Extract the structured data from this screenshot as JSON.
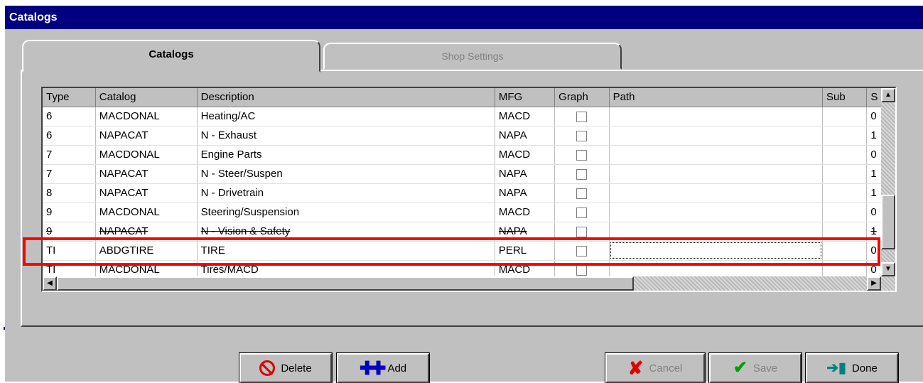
{
  "window": {
    "title": "Catalogs"
  },
  "tabs": [
    {
      "label": "Catalogs",
      "active": true
    },
    {
      "label": "Shop Settings",
      "active": false
    }
  ],
  "grid": {
    "columns": [
      "Type",
      "Catalog",
      "Description",
      "MFG",
      "Graph",
      "Path",
      "Sub",
      "S"
    ],
    "rows": [
      {
        "type": "6",
        "catalog": "MACDONAL",
        "description": "Heating/AC",
        "mfg": "MACD",
        "graph": false,
        "path": "",
        "sub": "",
        "s": "0"
      },
      {
        "type": "6",
        "catalog": "NAPACAT",
        "description": "N - Exhaust",
        "mfg": "NAPA",
        "graph": false,
        "path": "",
        "sub": "",
        "s": "1"
      },
      {
        "type": "7",
        "catalog": "MACDONAL",
        "description": "Engine Parts",
        "mfg": "MACD",
        "graph": false,
        "path": "",
        "sub": "",
        "s": "0"
      },
      {
        "type": "7",
        "catalog": "NAPACAT",
        "description": "N - Steer/Suspen",
        "mfg": "NAPA",
        "graph": false,
        "path": "",
        "sub": "",
        "s": "1"
      },
      {
        "type": "8",
        "catalog": "NAPACAT",
        "description": "N - Drivetrain",
        "mfg": "NAPA",
        "graph": false,
        "path": "",
        "sub": "",
        "s": "1"
      },
      {
        "type": "9",
        "catalog": "MACDONAL",
        "description": "Steering/Suspension",
        "mfg": "MACD",
        "graph": false,
        "path": "",
        "sub": "",
        "s": "0"
      },
      {
        "type": "9",
        "catalog": "NAPACAT",
        "description": "N - Vision & Safety",
        "mfg": "NAPA",
        "graph": false,
        "path": "",
        "sub": "",
        "s": "1"
      },
      {
        "type": "TI",
        "catalog": "ABDGTIRE",
        "description": "TIRE",
        "mfg": "PERL",
        "graph": false,
        "path": "",
        "sub": "",
        "s": "0"
      },
      {
        "type": "TI",
        "catalog": "MACDONAL",
        "description": "Tires/MACD",
        "mfg": "MACD",
        "graph": false,
        "path": "",
        "sub": "",
        "s": "0"
      }
    ],
    "selected_row": 7
  },
  "buttons": {
    "delete": "Delete",
    "add": "Add",
    "cancel": "Cancel",
    "save": "Save",
    "done": "Done"
  },
  "icons": {
    "delete": "no-entry-icon",
    "add": "plus-icon",
    "cancel": "red-x-icon",
    "save": "checkmark-icon",
    "done": "exit-door-icon",
    "scroll_up": "arrow-up-icon",
    "scroll_down": "arrow-down-icon",
    "scroll_left": "arrow-left-icon",
    "scroll_right": "arrow-right-icon"
  },
  "colors": {
    "titlebar": "#000080",
    "highlight": "#ff0000",
    "face": "#c0c0c0"
  }
}
